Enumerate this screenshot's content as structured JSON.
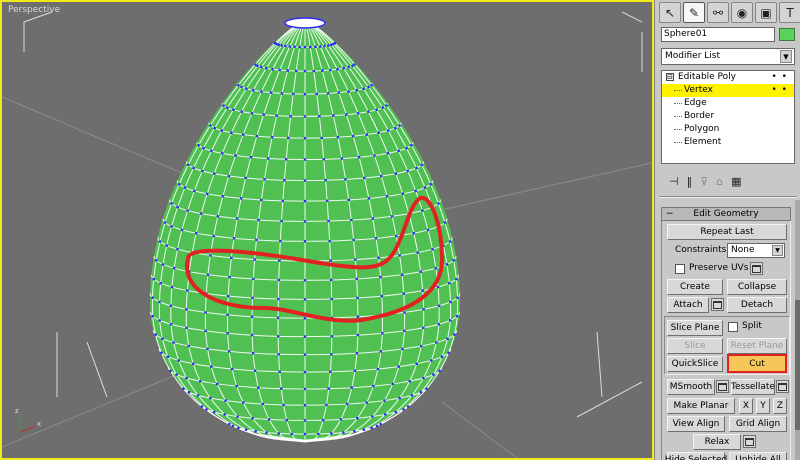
{
  "viewport": {
    "label": "Perspective",
    "object_color": "#59d15c",
    "highlight_color": "#e22222",
    "active_border_color": "#f2e81a"
  },
  "command_panel": {
    "tabs": [
      "create-icon",
      "modify-icon",
      "hierarchy-icon",
      "motion-icon",
      "display-icon",
      "utilities-icon"
    ],
    "tab_glyphs": [
      "↖",
      "✎",
      "⚯",
      "◉",
      "▣",
      "T"
    ],
    "active_tab": 1,
    "object_name": "Sphere01",
    "modifier_list_label": "Modifier List",
    "modifier_list_arrow": "▼",
    "stack": {
      "root": "Editable Poly",
      "root_toggle": "⊟",
      "root_dots": "• •",
      "items": [
        "Vertex",
        "Edge",
        "Border",
        "Polygon",
        "Element"
      ],
      "selected_index": 0
    },
    "stack_toolbar": [
      "⊣",
      "‖",
      "⊽",
      "⌂",
      "▦"
    ]
  },
  "edit_geometry": {
    "title": "Edit Geometry",
    "collapse_symbol": "−",
    "repeat_last": "Repeat Last",
    "constraints_label": "Constraints:",
    "constraints_value": "None",
    "preserve_uvs": "Preserve UVs",
    "create": "Create",
    "collapse": "Collapse",
    "attach": "Attach",
    "detach": "Detach",
    "slice_plane": "Slice Plane",
    "split": "Split",
    "slice": "Slice",
    "reset_plane": "Reset Plane",
    "quickslice": "QuickSlice",
    "cut": "Cut",
    "msmooth": "MSmooth",
    "tessellate": "Tessellate",
    "make_planar": "Make Planar",
    "x": "X",
    "y": "Y",
    "z": "Z",
    "view_align": "View Align",
    "grid_align": "Grid Align",
    "relax": "Relax",
    "hide_selected": "Hide Selected",
    "unhide_all": "Unhide All"
  }
}
